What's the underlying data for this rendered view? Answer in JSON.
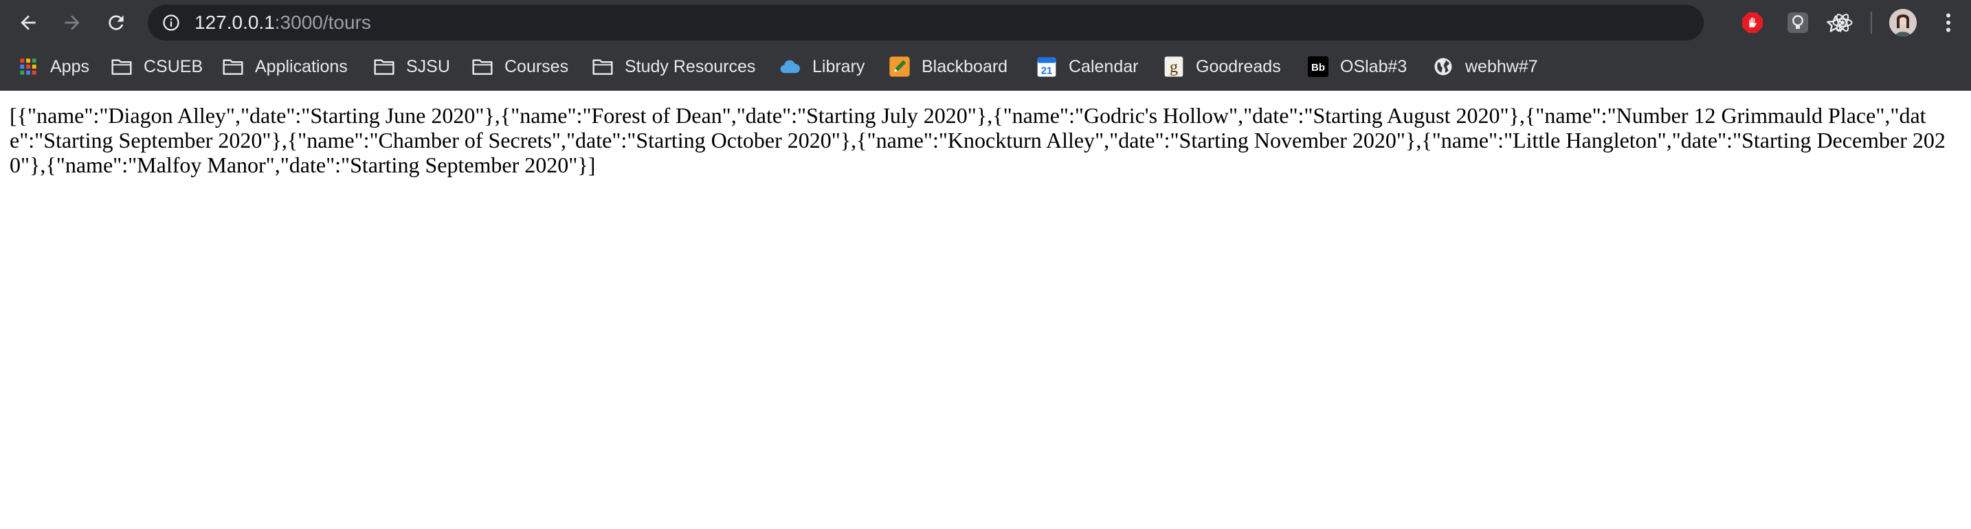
{
  "toolbar": {
    "back_icon": "arrow-left-icon",
    "forward_icon": "arrow-right-icon",
    "reload_icon": "reload-icon",
    "url_host": "127.0.0.1",
    "url_path": ":3000/tours",
    "bookmark_star_icon": "star-icon",
    "extensions": [
      "adblock-hand-icon",
      "bulb-icon",
      "react-atom-icon"
    ],
    "profile_icon": "avatar",
    "menu_icon": "kebab-menu-icon"
  },
  "bookmarks": [
    {
      "label": "Apps",
      "icon": "apps-grid-icon"
    },
    {
      "label": "CSUEB",
      "icon": "folder-icon"
    },
    {
      "label": "Applications",
      "icon": "folder-icon"
    },
    {
      "label": "SJSU",
      "icon": "folder-icon"
    },
    {
      "label": "Courses",
      "icon": "folder-icon"
    },
    {
      "label": "Study Resources",
      "icon": "folder-icon"
    },
    {
      "label": "Library",
      "icon": "cloud-icon"
    },
    {
      "label": "Blackboard",
      "icon": "blackboard-pencil-icon"
    },
    {
      "label": "Calendar",
      "icon": "calendar-icon",
      "icon_text": "21"
    },
    {
      "label": "Goodreads",
      "icon": "goodreads-icon",
      "icon_text": "g"
    },
    {
      "label": "OSlab#3",
      "icon": "bb-icon",
      "icon_text": "Bb"
    },
    {
      "label": "webhw#7",
      "icon": "globe-icon"
    }
  ],
  "page": {
    "json_text": "[{\"name\":\"Diagon Alley\",\"date\":\"Starting June 2020\"},{\"name\":\"Forest of Dean\",\"date\":\"Starting July 2020\"},{\"name\":\"Godric's Hollow\",\"date\":\"Starting August 2020\"},{\"name\":\"Number 12 Grimmauld Place\",\"date\":\"Starting September 2020\"},{\"name\":\"Chamber of Secrets\",\"date\":\"Starting October 2020\"},{\"name\":\"Knockturn Alley\",\"date\":\"Starting November 2020\"},{\"name\":\"Little Hangleton\",\"date\":\"Starting December 2020\"},{\"name\":\"Malfoy Manor\",\"date\":\"Starting September 2020\"}]"
  },
  "colors": {
    "toolbar_bg": "#35363a",
    "omnibox_bg": "#202124",
    "text_light": "#e8eaed",
    "text_dim": "#9aa0a6"
  }
}
